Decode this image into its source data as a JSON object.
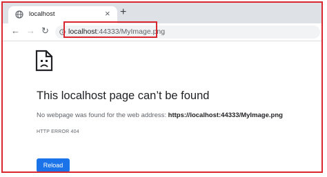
{
  "tab": {
    "title": "localhost",
    "close": "×",
    "new_tab": "+"
  },
  "toolbar": {
    "back": "←",
    "forward": "→",
    "reload": "↻"
  },
  "address_bar": {
    "host": "localhost",
    "rest": ":44333/MyImage.png"
  },
  "error_page": {
    "heading": "This localhost page can’t be found",
    "message_prefix": "No webpage was found for the web address: ",
    "message_url": "https://localhost:44333/MyImage.png",
    "error_code": "HTTP ERROR 404",
    "reload_label": "Reload"
  },
  "colors": {
    "accent": "#1a73e8",
    "highlight_border": "#d9252e",
    "tabstrip": "#dee1e6"
  },
  "icons": [
    "globe-icon",
    "info-icon",
    "sad-page-icon"
  ]
}
